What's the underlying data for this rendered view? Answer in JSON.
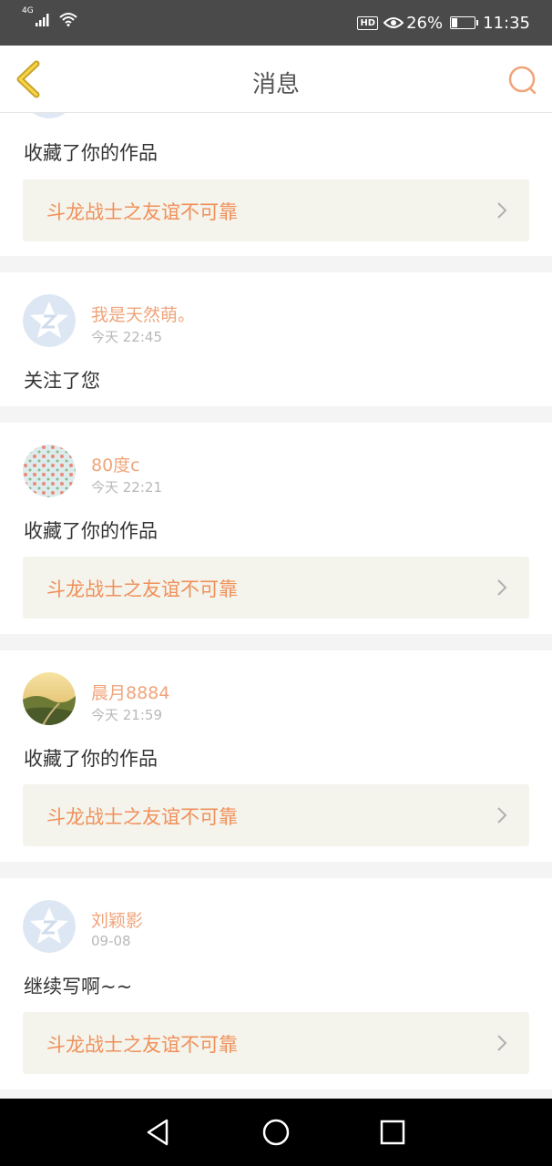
{
  "status_bar": {
    "network": "4G",
    "battery_text": "26%",
    "battery_level": 0.26,
    "time": "11:35",
    "hd_label": "HD"
  },
  "header": {
    "title": "消息",
    "back_icon": "chevron-left-icon",
    "search_icon": "search-icon"
  },
  "messages": [
    {
      "action": "收藏了你的作品",
      "work_title": "斗龙战士之友谊不可靠"
    },
    {
      "username": "我是天然萌。",
      "time": "今天 22:45",
      "action": "关注了您",
      "avatar": "default-avatar-icon"
    },
    {
      "username": "80度c",
      "time": "今天 22:21",
      "action": "收藏了你的作品",
      "work_title": "斗龙战士之友谊不可靠",
      "avatar": "pattern-avatar"
    },
    {
      "username": "晨月8884",
      "time": "今天 21:59",
      "action": "收藏了你的作品",
      "work_title": "斗龙战士之友谊不可靠",
      "avatar": "landscape-avatar"
    },
    {
      "username": "刘颖影",
      "time": "09-08",
      "action": "继续写啊~~",
      "work_title": "斗龙战士之友谊不可靠",
      "avatar": "default-avatar-icon"
    }
  ],
  "colors": {
    "accent": "#f0905a",
    "username": "#f0a47a",
    "card_link_bg": "#f4f4ec"
  },
  "nav_bar": {
    "back_icon": "triangle-back-icon",
    "home_icon": "circle-home-icon",
    "recents_icon": "square-recents-icon"
  }
}
